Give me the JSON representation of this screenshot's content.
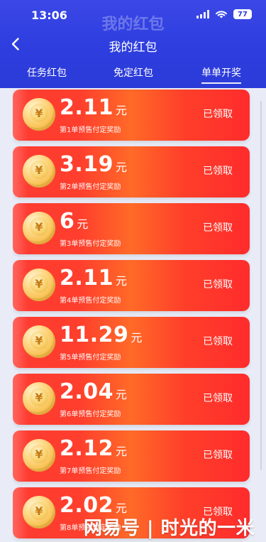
{
  "status_bar": {
    "time": "13:06",
    "battery": "77"
  },
  "header": {
    "ghost_title": "我的红包",
    "title": "我的红包"
  },
  "tabs": [
    {
      "label": "任务红包"
    },
    {
      "label": "免定红包"
    },
    {
      "label": "单单开奖"
    }
  ],
  "cards": [
    {
      "amount": "2.11",
      "unit": "元",
      "subtitle": "第1单预售付定奖励",
      "status": "已领取"
    },
    {
      "amount": "3.19",
      "unit": "元",
      "subtitle": "第2单预售付定奖励",
      "status": "已领取"
    },
    {
      "amount": "6",
      "unit": "元",
      "subtitle": "第3单预售付定奖励",
      "status": "已领取"
    },
    {
      "amount": "2.11",
      "unit": "元",
      "subtitle": "第4单预售付定奖励",
      "status": "已领取"
    },
    {
      "amount": "11.29",
      "unit": "元",
      "subtitle": "第5单预售付定奖励",
      "status": "已领取"
    },
    {
      "amount": "2.04",
      "unit": "元",
      "subtitle": "第6单预售付定奖励",
      "status": "已领取"
    },
    {
      "amount": "2.12",
      "unit": "元",
      "subtitle": "第7单预售付定奖励",
      "status": "已领取"
    },
    {
      "amount": "2.02",
      "unit": "元",
      "subtitle": "第8单预售付定奖励",
      "status": "已领取"
    }
  ],
  "watermark": "网易号 | 时光的一米",
  "icons": {
    "back": "chevron-left-icon",
    "coin": "yuan-coin-icon",
    "signal": "signal-icon",
    "wifi": "wifi-icon",
    "battery": "battery-icon"
  },
  "colors": {
    "header_blue": "#2f3fe0",
    "card_red": "#ff3b32",
    "card_orange": "#ff6a28",
    "coin_gold": "#f7bd4a"
  }
}
